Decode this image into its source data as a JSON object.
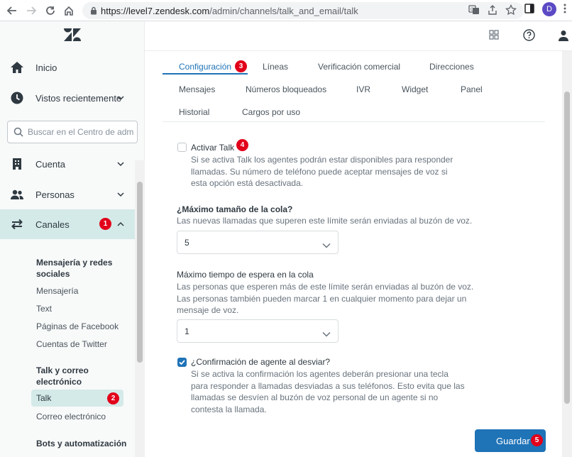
{
  "browser": {
    "url_host": "https://level7.zendesk.com",
    "url_path": "/admin/channels/talk_and_email/talk",
    "avatar_letter": "D"
  },
  "sidebar": {
    "home_label": "Inicio",
    "recent_label": "Vistos recientemente",
    "search_placeholder": "Buscar en el Centro de administración",
    "account_label": "Cuenta",
    "people_label": "Personas",
    "channels_label": "Canales",
    "channels_badge": "1",
    "messaging_heading": "Mensajería y redes sociales",
    "messaging_links": [
      "Mensajería",
      "Text",
      "Páginas de Facebook",
      "Cuentas de Twitter"
    ],
    "talk_heading": "Talk y correo electrónico",
    "talk_link": "Talk",
    "talk_badge": "2",
    "email_link": "Correo electrónico",
    "bots_heading": "Bots y automatización"
  },
  "tabs": {
    "row1": [
      "Configuración",
      "Líneas",
      "Verificación comercial",
      "Direcciones"
    ],
    "row2": [
      "Mensajes",
      "Números bloqueados",
      "IVR",
      "Widget",
      "Panel"
    ],
    "row3": [
      "Historial",
      "Cargos por uso"
    ],
    "active_badge": "3"
  },
  "form": {
    "enable_talk": {
      "label": "Activar Talk",
      "checked": false,
      "badge": "4",
      "hint": "Si se activa Talk los agentes podrán estar disponibles para responder llamadas. Su número de teléfono puede aceptar mensajes de voz si esta opción está desactivada."
    },
    "max_queue": {
      "label": "¿Máximo tamaño de la cola?",
      "hint": "Las nuevas llamadas que superen este límite serán enviadas al buzón de voz.",
      "value": "5"
    },
    "max_wait": {
      "label": "Máximo tiempo de espera en la cola",
      "hint": "Las personas que esperen más de este límite serán enviadas al buzón de voz. Las personas también pueden marcar 1 en cualquier momento para dejar un mensaje de voz.",
      "value": "1"
    },
    "agent_confirm": {
      "label": "¿Confirmación de agente al desviar?",
      "checked": true,
      "hint": "Si se activa la confirmación los agentes deberán presionar una tecla para responder a llamadas desviadas a sus teléfonos. Esto evita que las llamadas se desvíen al buzón de voz personal de un agente si no contesta la llamada."
    },
    "save_label": "Guardar",
    "save_badge": "5"
  },
  "colors": {
    "accent": "#1f73b7",
    "badge": "#e2001a",
    "active_bg": "#d4eae9"
  }
}
